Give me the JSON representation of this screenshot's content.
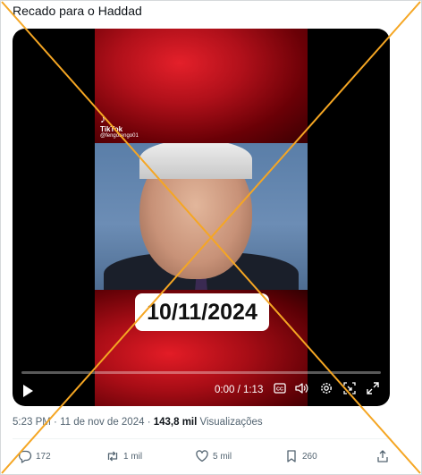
{
  "post": {
    "text": "Recado para o Haddad"
  },
  "video": {
    "tiktok_label": "TikTok",
    "tiktok_handle": "@fengotengo01",
    "date_caption": "10/11/2024",
    "time": "0:00 / 1:13",
    "progress": 0.0
  },
  "meta": {
    "time": "5:23 PM",
    "separator1": " · ",
    "date": "11 de nov de 2024",
    "separator2": " · ",
    "views_count": "143,8 mil",
    "views_label": " Visualizações"
  },
  "actions": {
    "replies": "172",
    "reposts": "1 mil",
    "likes": "5 mil",
    "bookmarks": "260"
  },
  "overlay": {
    "cross_color": "#f5a623"
  },
  "icons": [
    "play-icon",
    "closed-captions-icon",
    "volume-icon",
    "settings-icon",
    "picture-in-picture-icon",
    "fullscreen-icon",
    "reply-icon",
    "repost-icon",
    "like-icon",
    "bookmark-icon",
    "share-icon"
  ]
}
